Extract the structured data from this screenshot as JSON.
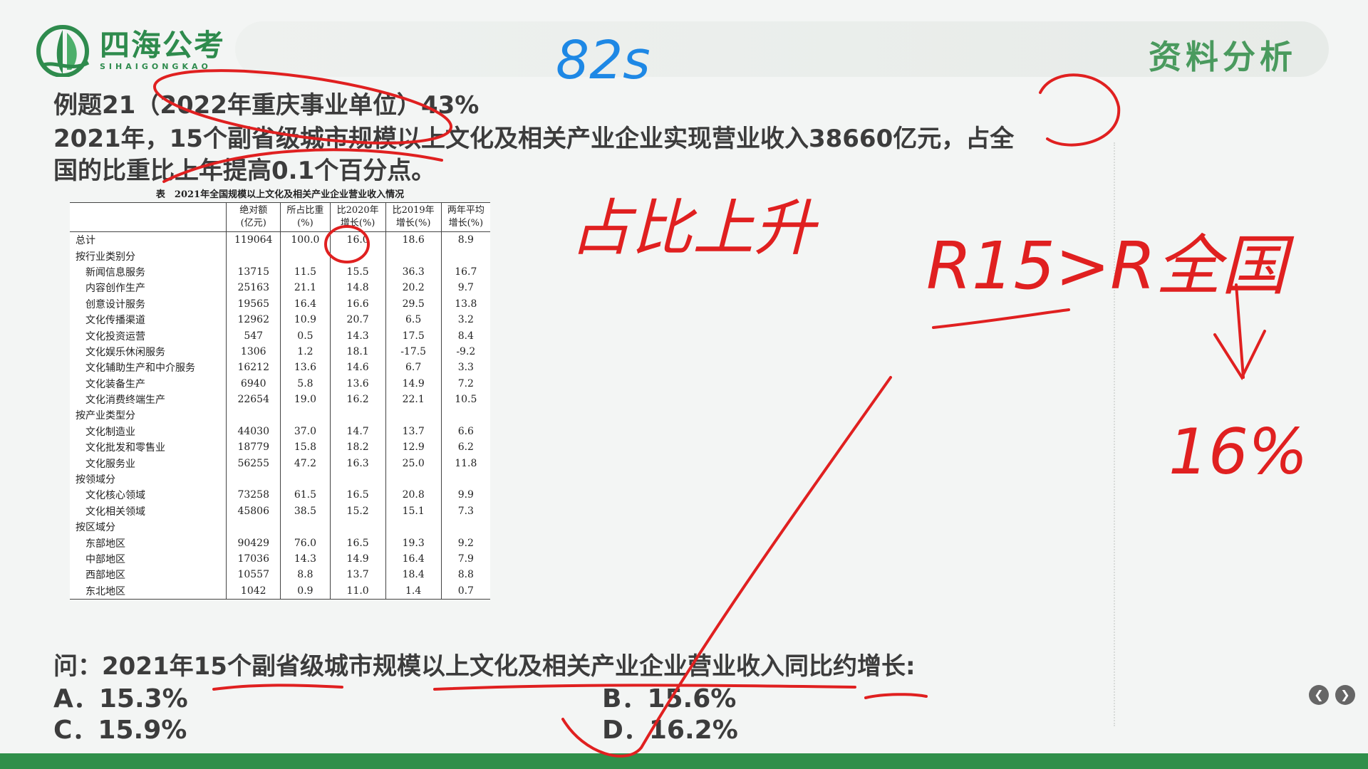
{
  "brand": {
    "name_cn": "四海公考",
    "name_en": "SIHAIGONGKAO"
  },
  "section_title": "资料分析",
  "question": {
    "header": "例题21（2022年重庆事业单位）43%",
    "stem_line1": "2021年，15个副省级城市规模以上文化及相关产业企业实现营业收入38660亿元，占全",
    "stem_line2": "国的比重比上年提高0.1个百分点。",
    "ask": "问：2021年15个副省级城市规模以上文化及相关产业企业营业收入同比约增长:",
    "options": [
      {
        "id": "A",
        "text": "A．15.3%"
      },
      {
        "id": "B",
        "text": "B．15.6%"
      },
      {
        "id": "C",
        "text": "C．15.9%"
      },
      {
        "id": "D",
        "text": "D．16.2%"
      }
    ]
  },
  "table": {
    "caption": "表　2021年全国规模以上文化及相关产业企业营业收入情况",
    "headers": [
      "",
      "绝对额\n(亿元)",
      "所占比重\n(%)",
      "比2020年\n增长(%)",
      "比2019年\n增长(%)",
      "两年平均\n增长(%)"
    ],
    "rows": [
      {
        "name": "总计",
        "indent": false,
        "values": [
          "119064",
          "100.0",
          "16.0",
          "18.6",
          "8.9"
        ]
      },
      {
        "name": "按行业类别分",
        "indent": false,
        "values": [
          "",
          "",
          "",
          "",
          ""
        ]
      },
      {
        "name": "新闻信息服务",
        "indent": true,
        "values": [
          "13715",
          "11.5",
          "15.5",
          "36.3",
          "16.7"
        ]
      },
      {
        "name": "内容创作生产",
        "indent": true,
        "values": [
          "25163",
          "21.1",
          "14.8",
          "20.2",
          "9.7"
        ]
      },
      {
        "name": "创意设计服务",
        "indent": true,
        "values": [
          "19565",
          "16.4",
          "16.6",
          "29.5",
          "13.8"
        ]
      },
      {
        "name": "文化传播渠道",
        "indent": true,
        "values": [
          "12962",
          "10.9",
          "20.7",
          "6.5",
          "3.2"
        ]
      },
      {
        "name": "文化投资运营",
        "indent": true,
        "values": [
          "547",
          "0.5",
          "14.3",
          "17.5",
          "8.4"
        ]
      },
      {
        "name": "文化娱乐休闲服务",
        "indent": true,
        "values": [
          "1306",
          "1.2",
          "18.1",
          "-17.5",
          "-9.2"
        ]
      },
      {
        "name": "文化辅助生产和中介服务",
        "indent": true,
        "values": [
          "16212",
          "13.6",
          "14.6",
          "6.7",
          "3.3"
        ]
      },
      {
        "name": "文化装备生产",
        "indent": true,
        "values": [
          "6940",
          "5.8",
          "13.6",
          "14.9",
          "7.2"
        ]
      },
      {
        "name": "文化消费终端生产",
        "indent": true,
        "values": [
          "22654",
          "19.0",
          "16.2",
          "22.1",
          "10.5"
        ]
      },
      {
        "name": "按产业类型分",
        "indent": false,
        "values": [
          "",
          "",
          "",
          "",
          ""
        ]
      },
      {
        "name": "文化制造业",
        "indent": true,
        "values": [
          "44030",
          "37.0",
          "14.7",
          "13.7",
          "6.6"
        ]
      },
      {
        "name": "文化批发和零售业",
        "indent": true,
        "values": [
          "18779",
          "15.8",
          "18.2",
          "12.9",
          "6.2"
        ]
      },
      {
        "name": "文化服务业",
        "indent": true,
        "values": [
          "56255",
          "47.2",
          "16.3",
          "25.0",
          "11.8"
        ]
      },
      {
        "name": "按领域分",
        "indent": false,
        "values": [
          "",
          "",
          "",
          "",
          ""
        ]
      },
      {
        "name": "文化核心领域",
        "indent": true,
        "values": [
          "73258",
          "61.5",
          "16.5",
          "20.8",
          "9.9"
        ]
      },
      {
        "name": "文化相关领域",
        "indent": true,
        "values": [
          "45806",
          "38.5",
          "15.2",
          "15.1",
          "7.3"
        ]
      },
      {
        "name": "按区域分",
        "indent": false,
        "values": [
          "",
          "",
          "",
          "",
          ""
        ]
      },
      {
        "name": "东部地区",
        "indent": true,
        "values": [
          "90429",
          "76.0",
          "16.5",
          "19.3",
          "9.2"
        ]
      },
      {
        "name": "中部地区",
        "indent": true,
        "values": [
          "17036",
          "14.3",
          "14.9",
          "16.4",
          "7.9"
        ]
      },
      {
        "name": "西部地区",
        "indent": true,
        "values": [
          "10557",
          "8.8",
          "13.7",
          "18.4",
          "8.8"
        ]
      },
      {
        "name": "东北地区",
        "indent": true,
        "values": [
          "1042",
          "0.9",
          "11.0",
          "1.4",
          "0.7"
        ]
      }
    ]
  },
  "handwriting": {
    "top_note": "82s",
    "note_proportion": "占比上升",
    "note_formula": "R15>R全国",
    "note_result": "16%",
    "check_mark": "D"
  },
  "nav": {
    "prev": "K",
    "next": "K"
  },
  "colors": {
    "brand_green": "#2e8b4d",
    "ink_red": "#e02020",
    "ink_blue": "#1e88e5",
    "bottom_bar": "#2f8f4a"
  }
}
